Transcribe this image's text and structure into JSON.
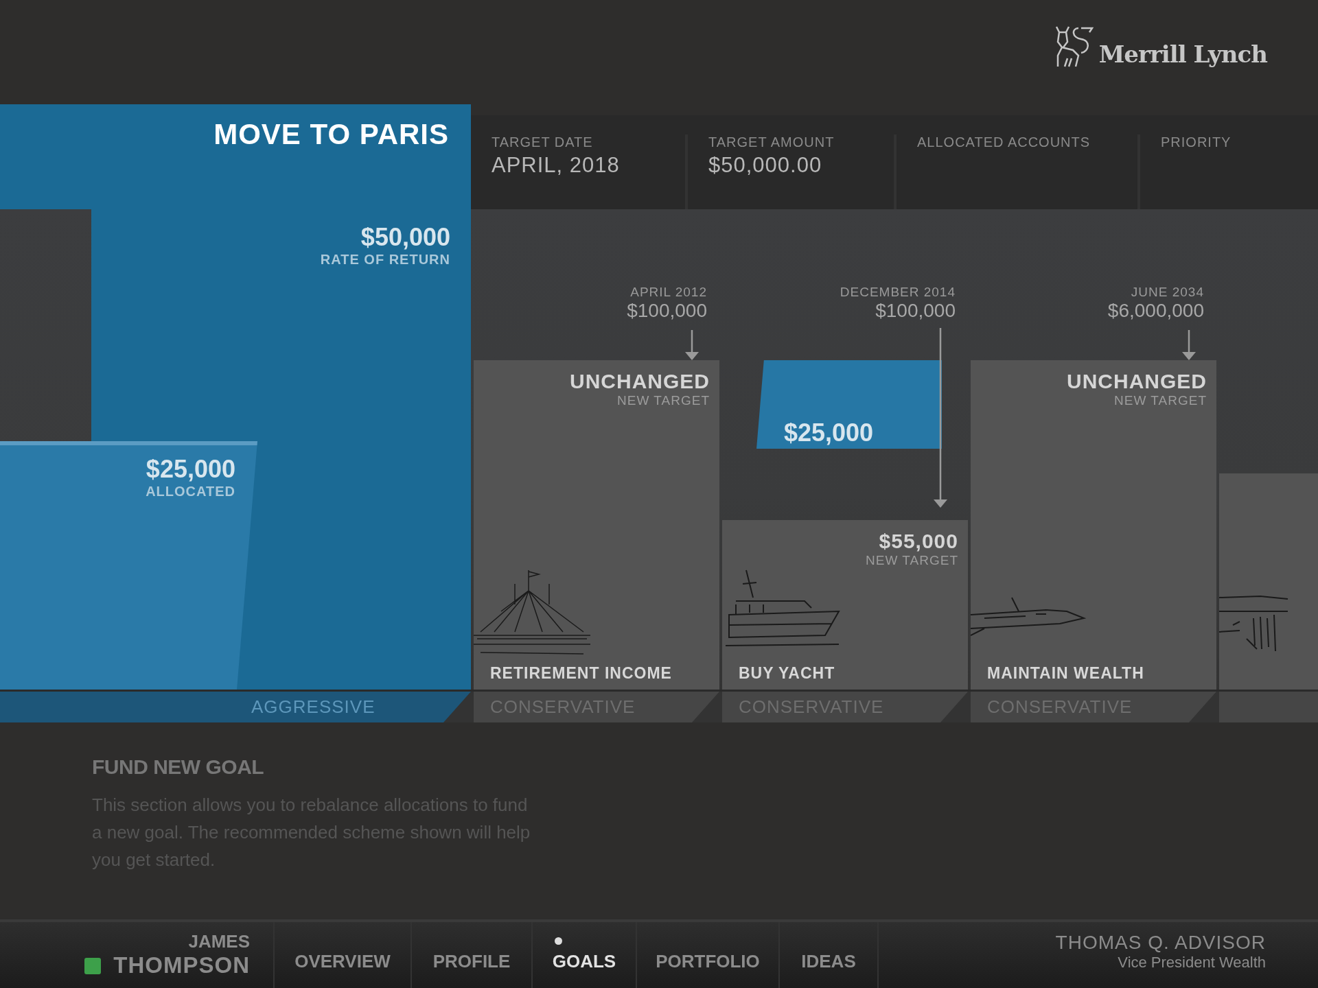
{
  "brand": {
    "name": "Merrill Lynch"
  },
  "goal": {
    "title": "MOVE TO PARIS",
    "amount": "$50,000",
    "amount_label": "RATE OF RETURN",
    "allocated": "$25,000",
    "allocated_label": "ALLOCATED",
    "risk": "AGGRESSIVE"
  },
  "fields": [
    {
      "label": "TARGET DATE",
      "value": "APRIL, 2018"
    },
    {
      "label": "TARGET AMOUNT",
      "value": "$50,000.00"
    },
    {
      "label": "ALLOCATED ACCOUNTS"
    },
    {
      "label": "PRIORITY"
    }
  ],
  "goals": [
    {
      "kind": "unchanged",
      "date": "APRIL 2012",
      "amount": "$100,000",
      "status": "UNCHANGED",
      "status_label": "NEW TARGET",
      "name": "RETIREMENT INCOME",
      "risk": "CONSERVATIVE"
    },
    {
      "kind": "changed",
      "date": "DECEMBER 2014",
      "amount": "$100,000",
      "moved": "$25,000",
      "new_target": "$55,000",
      "new_target_label": "NEW TARGET",
      "name": "BUY YACHT",
      "risk": "CONSERVATIVE"
    },
    {
      "kind": "unchanged",
      "date": "JUNE 2034",
      "amount": "$6,000,000",
      "status": "UNCHANGED",
      "status_label": "NEW TARGET",
      "name": "MAINTAIN WEALTH",
      "risk": "CONSERVATIVE"
    },
    {
      "kind": "partial"
    }
  ],
  "info": {
    "title": "FUND NEW GOAL",
    "text": "This section allows you to rebalance allocations to fund a new goal. The recommended scheme shown will help you get started."
  },
  "client": {
    "first_name": "JAMES",
    "last_name": "THOMPSON",
    "online": true
  },
  "tabs": [
    {
      "label": "OVERVIEW",
      "selected": false
    },
    {
      "label": "PROFILE",
      "selected": false
    },
    {
      "label": "GOALS",
      "selected": true
    },
    {
      "label": "PORTFOLIO",
      "selected": false
    },
    {
      "label": "IDEAS",
      "selected": false
    }
  ],
  "advisor": {
    "name": "THOMAS Q. ADVISOR",
    "title": "Vice President Wealth"
  }
}
